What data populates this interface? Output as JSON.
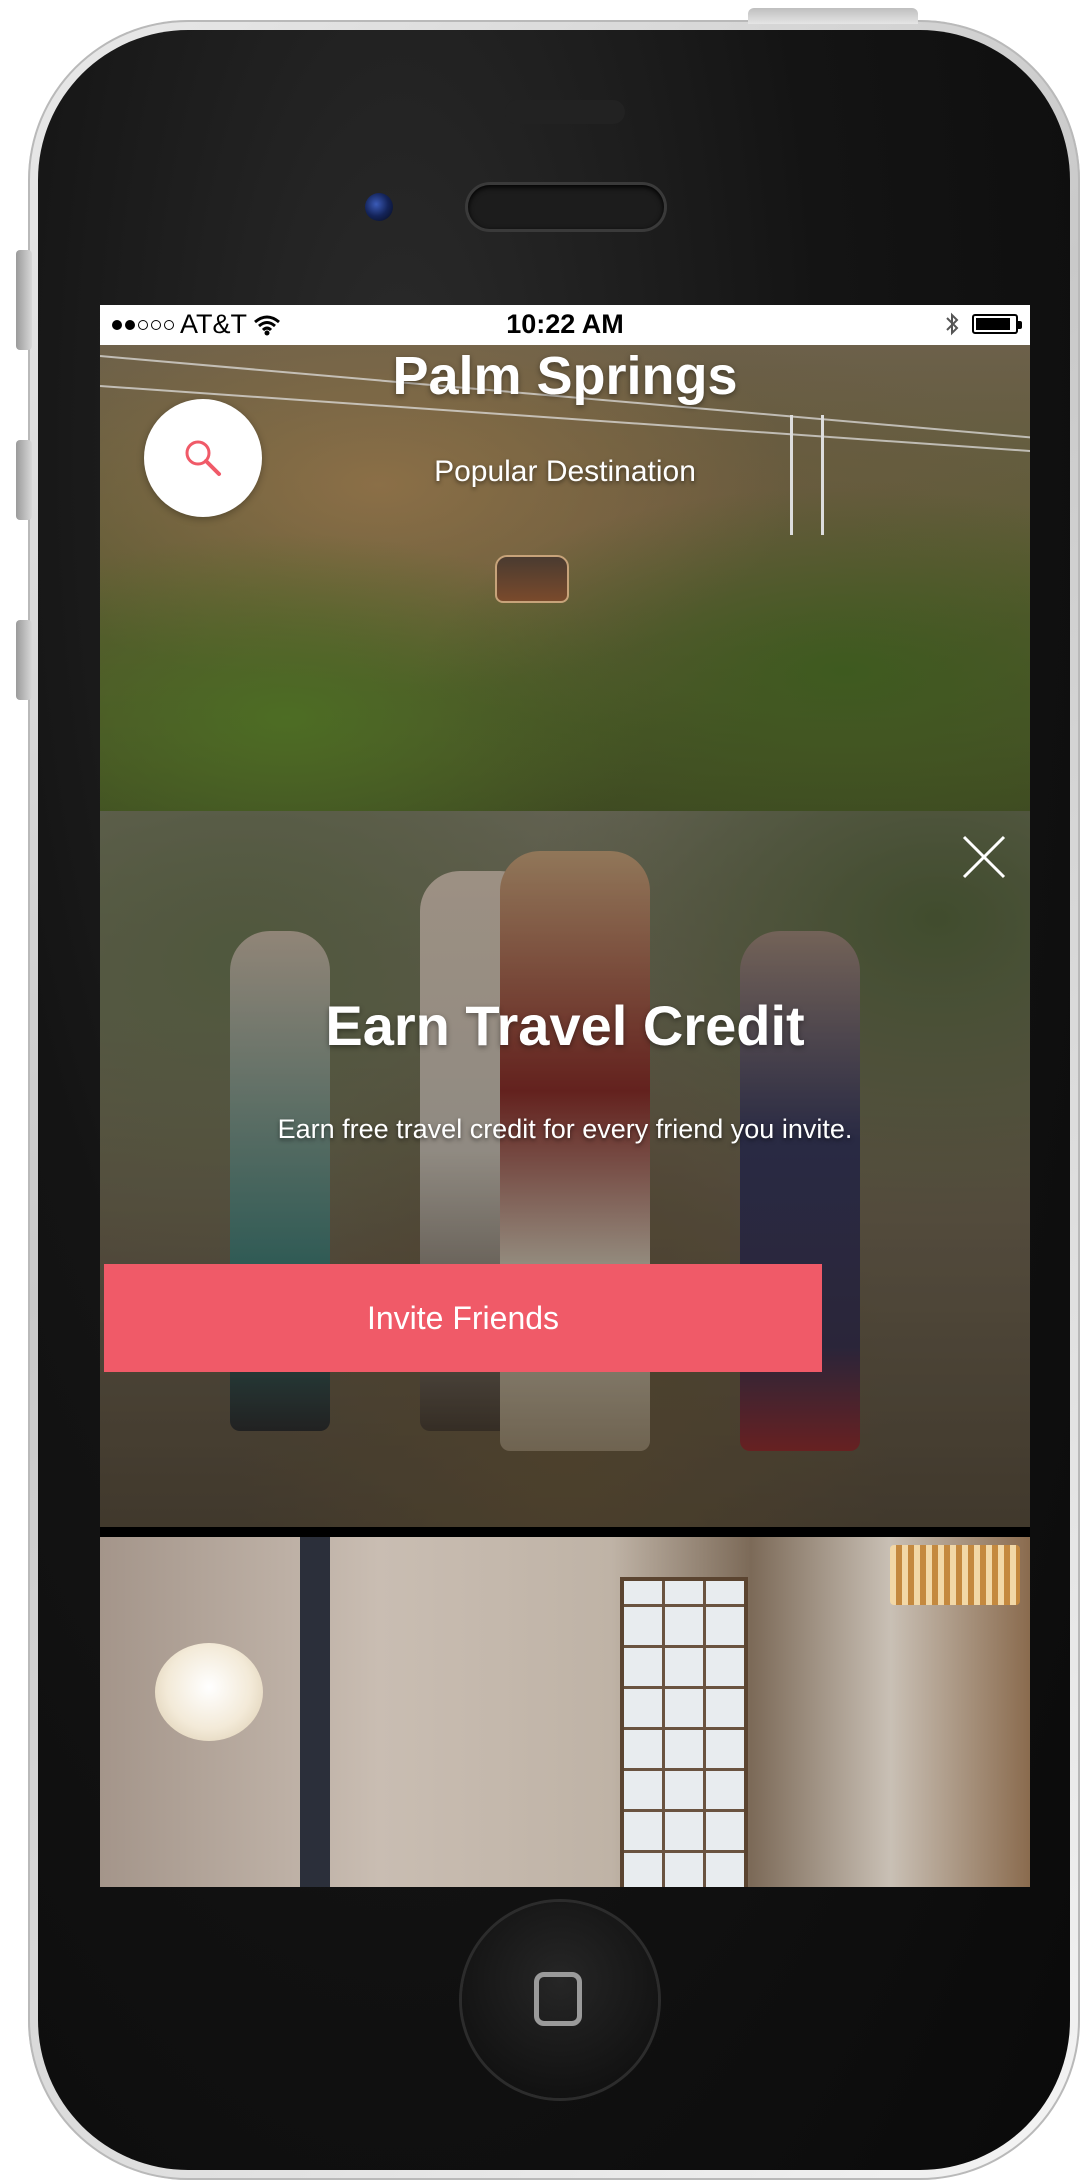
{
  "status_bar": {
    "carrier": "AT&T",
    "time": "10:22 AM"
  },
  "hero": {
    "title": "Palm Springs",
    "subtitle": "Popular Destination"
  },
  "promo": {
    "title": "Earn Travel Credit",
    "description": "Earn free travel credit for every friend you invite.",
    "button_label": "Invite Friends"
  },
  "colors": {
    "accent": "#f05a68",
    "search_icon": "#f05a68"
  },
  "icons": {
    "search": "search-icon",
    "close": "close-icon",
    "wifi": "wifi-icon",
    "bluetooth": "bluetooth-icon",
    "battery": "battery-icon"
  }
}
